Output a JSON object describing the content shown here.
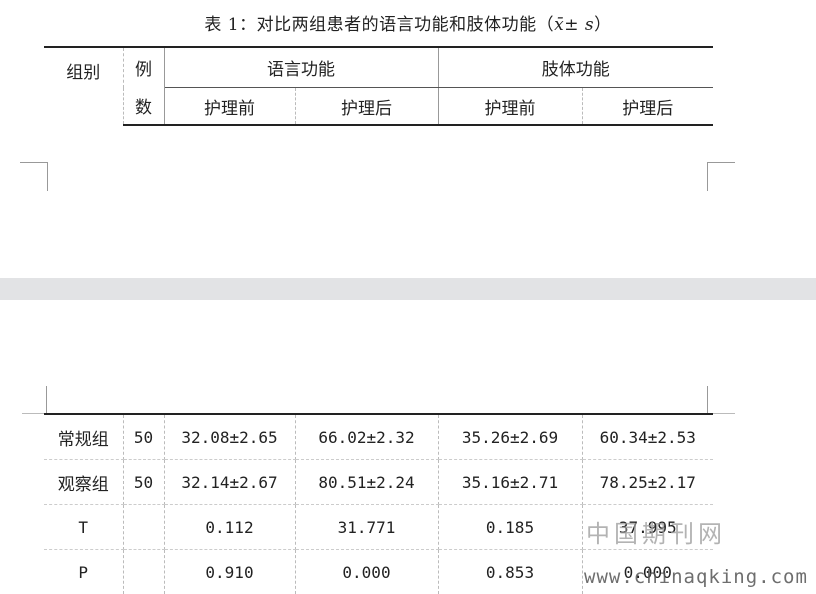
{
  "title": {
    "prefix": "表 1：对比两组患者的语言功能和肢体功能（",
    "stat": "x̄± s",
    "suffix": "）"
  },
  "header": {
    "group": "组别",
    "count_line1": "例",
    "count_line2": "数",
    "language": "语言功能",
    "limb": "肢体功能",
    "before": "护理前",
    "after": "护理后"
  },
  "rows": [
    {
      "group": "常规组",
      "n": "50",
      "lang_before": "32.08±2.65",
      "lang_after": "66.02±2.32",
      "limb_before": "35.26±2.69",
      "limb_after": "60.34±2.53"
    },
    {
      "group": "观察组",
      "n": "50",
      "lang_before": "32.14±2.67",
      "lang_after": "80.51±2.24",
      "limb_before": "35.16±2.71",
      "limb_after": "78.25±2.17"
    },
    {
      "group": "T",
      "n": "",
      "lang_before": "0.112",
      "lang_after": "31.771",
      "limb_before": "0.185",
      "limb_after": "37.995"
    },
    {
      "group": "P",
      "n": "",
      "lang_before": "0.910",
      "lang_after": "0.000",
      "limb_before": "0.853",
      "limb_after": "0.000"
    }
  ],
  "watermark": {
    "cn": "中国期刊网",
    "url": "www.chinaqking.com"
  }
}
